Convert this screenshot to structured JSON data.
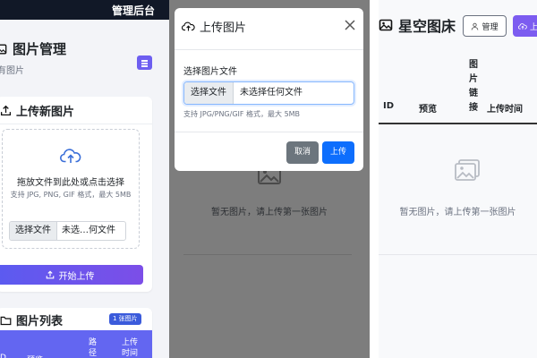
{
  "panel1": {
    "topbar": {
      "title": "管理后台",
      "left_text": "≡"
    },
    "header": {
      "title": "图片管理",
      "subtitle": "有图片"
    },
    "upload_card": {
      "title": "上传新图片",
      "drop_main": "拖放文件到此处或点击选择",
      "drop_hint": "支持 JPG, PNG, GIF 格式，最大 5MB",
      "file_button": "选择文件",
      "file_name": "未选…何文件",
      "start_button": "开始上传"
    },
    "list_card": {
      "title": "图片列表",
      "badge": "1 张图片",
      "columns": [
        "D",
        "预览",
        "路径",
        "上传时间"
      ]
    }
  },
  "panel2": {
    "modal": {
      "title": "上传图片",
      "label": "选择图片文件",
      "file_button": "选择文件",
      "file_name": "未选择任何文件",
      "hint": "支持 JPG/PNG/GIF 格式，最大 5MB",
      "cancel": "取消",
      "upload": "上传"
    },
    "empty_text": "暂无图片，请上传第一张图片"
  },
  "panel3": {
    "brand": "星空图床",
    "manage_button": "管理",
    "upload_button": "上",
    "columns": [
      "ID",
      "预览",
      "图片链接",
      "上传时间"
    ],
    "empty_text": "暂无图片，请上传第一张图片"
  },
  "colors": {
    "primary": "#0d6efd",
    "purple": "#6d5ef0",
    "gradient_start": "#5b5bf0",
    "gradient_end": "#7c4ee8",
    "dark_topbar": "#111827",
    "overlay": "#7d7d7d",
    "secondary": "#6c757d"
  },
  "icons": [
    "image-icon",
    "cloud-upload-icon",
    "upload-icon",
    "folder-icon",
    "close-icon",
    "user-icon",
    "menu-icon"
  ]
}
